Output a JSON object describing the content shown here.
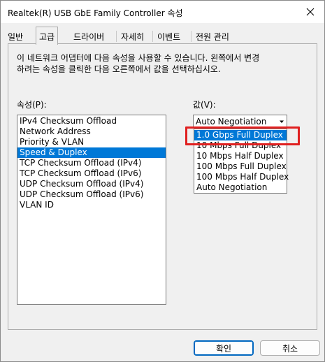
{
  "window": {
    "title": "Realtek(R) USB GbE Family Controller 속성"
  },
  "tabs": [
    {
      "label": "일반"
    },
    {
      "label": "고급"
    },
    {
      "label": "드라이버"
    },
    {
      "label": "자세히"
    },
    {
      "label": "이벤트"
    },
    {
      "label": "전원 관리"
    }
  ],
  "active_tab": "고급",
  "panel": {
    "description": "이 네트워크 어댑터에 다음 속성을 사용할 수 있습니다. 왼쪽에서 변경\n하려는 속성을 클릭한 다음 오른쪽에서 값을 선택하십시오.",
    "property_label": "속성(P):",
    "value_label": "값(V):",
    "properties": [
      {
        "label": "IPv4 Checksum Offload"
      },
      {
        "label": "Network Address"
      },
      {
        "label": "Priority & VLAN"
      },
      {
        "label": "Speed & Duplex"
      },
      {
        "label": "TCP Checksum Offload (IPv4)"
      },
      {
        "label": "TCP Checksum Offload (IPv6)"
      },
      {
        "label": "UDP Checksum Offload (IPv4)"
      },
      {
        "label": "UDP Checksum Offload (IPv6)"
      },
      {
        "label": "VLAN ID"
      }
    ],
    "selected_property": "Speed & Duplex",
    "value_combo": {
      "current": "Auto Negotiation",
      "options": [
        {
          "label": "1.0 Gbps Full Duplex"
        },
        {
          "label": "10 Mbps Full Duplex"
        },
        {
          "label": "10 Mbps Half Duplex"
        },
        {
          "label": "100 Mbps Full Duplex"
        },
        {
          "label": "100 Mbps Half Duplex"
        },
        {
          "label": "Auto Negotiation"
        }
      ],
      "highlighted": "1.0 Gbps Full Duplex"
    }
  },
  "buttons": {
    "ok": "확인",
    "cancel": "취소"
  },
  "colors": {
    "selection": "#0078d7",
    "highlight_box": "#e02020",
    "primary_border": "#0067c0"
  }
}
